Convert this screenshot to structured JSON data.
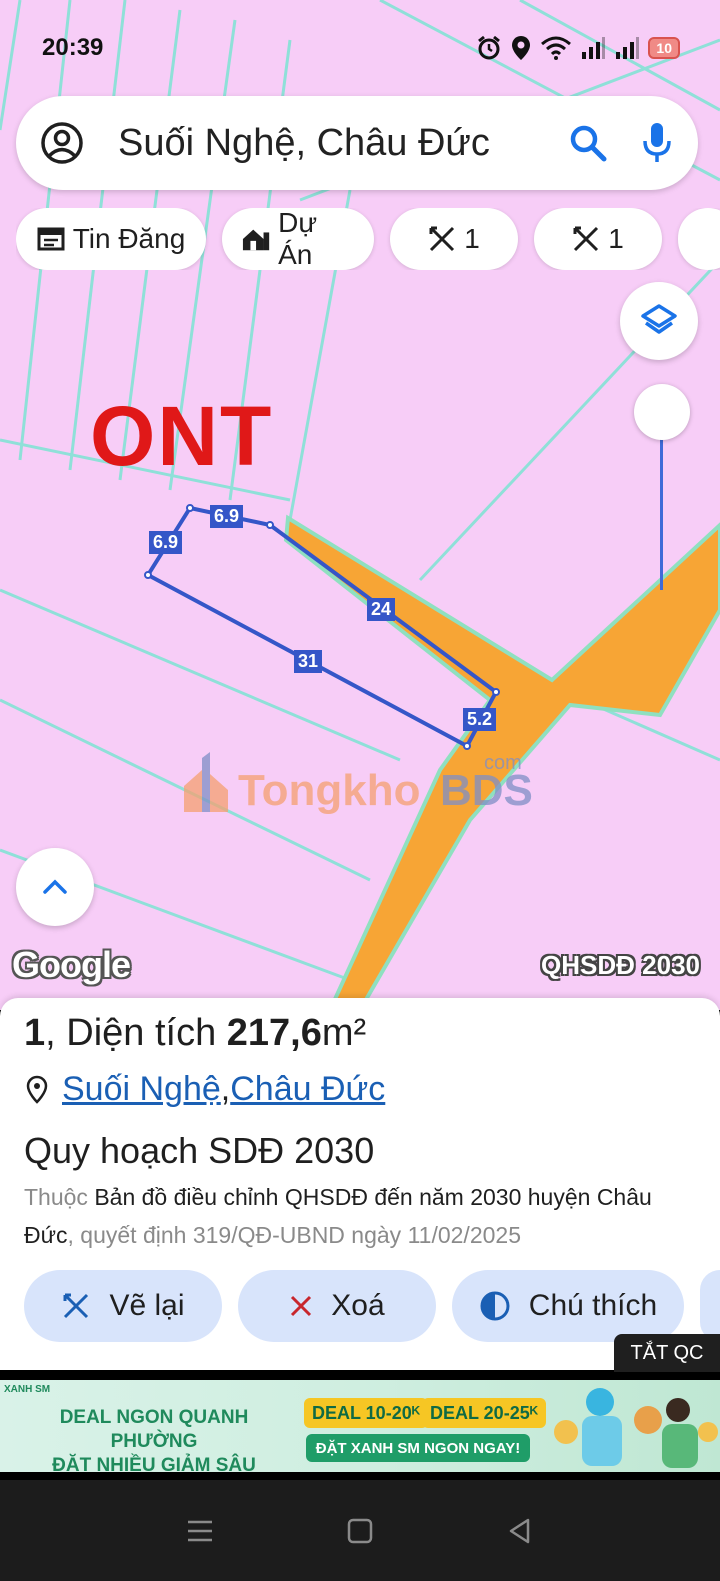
{
  "status_bar": {
    "time": "20:39",
    "battery": "10"
  },
  "search": {
    "query": "Suối Nghệ, Châu Đức"
  },
  "chips": [
    {
      "icon": "listing-icon",
      "label": "Tin Đăng"
    },
    {
      "icon": "project-icon",
      "label": "Dự Án"
    },
    {
      "icon": "measure-icon",
      "label": "1"
    },
    {
      "icon": "measure-icon",
      "label": "1"
    }
  ],
  "map": {
    "zone_label": "ONT",
    "watermark": {
      "brand_a": "Tongkho",
      "brand_b": "BDS",
      "suffix": "com"
    },
    "edge_labels": [
      "6.9",
      "6.9",
      "24",
      "31",
      "5.2"
    ],
    "google_logo": "Google",
    "layer_name": "QHSDĐ 2030",
    "colors": {
      "land": "#f7cdf7",
      "road": "#f7a535",
      "road_border": "#8fe0c0",
      "parcel": "#3556c8"
    }
  },
  "sheet": {
    "count": "1",
    "area_prefix": ", Diện tích ",
    "area_value": "217,6",
    "area_unit": "m²",
    "location_a": "Suối Nghệ",
    "location_sep": ", ",
    "location_b": "Châu Đức",
    "plan_title": "Quy hoạch SDĐ 2030",
    "source_prefix": "Thuộc ",
    "source_name": "Bản đồ điều chỉnh QHSDĐ đến năm 2030 huyện Châu Đức",
    "source_suffix": ", quyết định 319/QĐ-UBND ngày 11/02/2025",
    "actions": [
      {
        "icon": "redraw-icon",
        "label": "Vẽ lại"
      },
      {
        "icon": "close-icon",
        "label": "Xoá"
      },
      {
        "icon": "contrast-icon",
        "label": "Chú thích"
      }
    ],
    "ad_toggle": "TẮT QC"
  },
  "ad": {
    "logo": "XANH SM",
    "headline_1": "DEAL NGON QUANH PHƯỜNG",
    "headline_2": "ĐẶT NHIỀU GIẢM SÂU",
    "deal_1": "DEAL 10-20ᴷ",
    "deal_2": "DEAL 20-25ᴷ",
    "cta": "ĐẶT XANH SM NGON NGAY!"
  }
}
